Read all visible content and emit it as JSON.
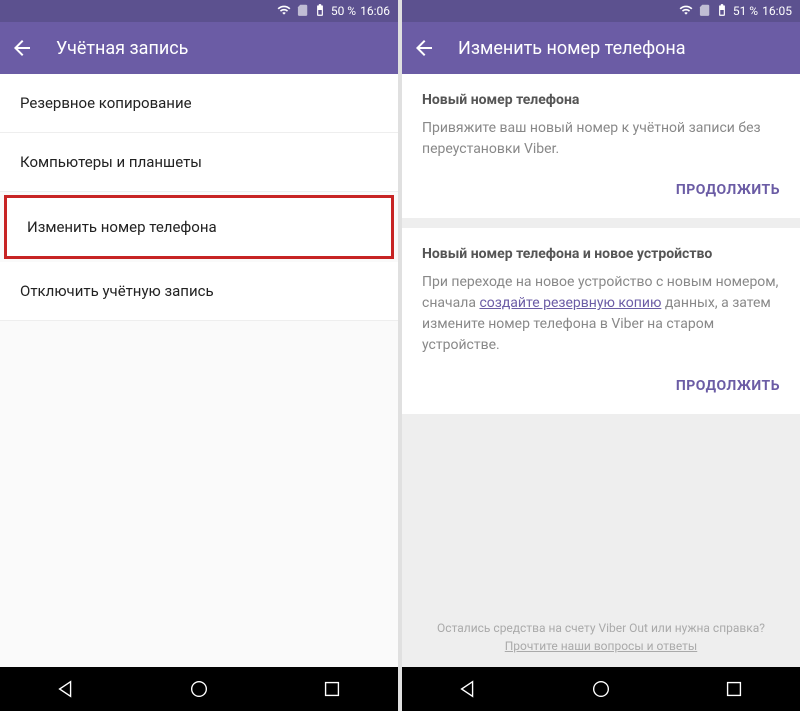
{
  "left": {
    "status": {
      "battery": "50 %",
      "time": "16:06"
    },
    "appbar_title": "Учётная запись",
    "items": [
      {
        "label": "Резервное копирование"
      },
      {
        "label": "Компьютеры и планшеты"
      },
      {
        "label": "Изменить номер телефона"
      },
      {
        "label": "Отключить учётную запись"
      }
    ]
  },
  "right": {
    "status": {
      "battery": "51 %",
      "time": "16:05"
    },
    "appbar_title": "Изменить номер телефона",
    "card1": {
      "title": "Новый номер телефона",
      "body": "Привяжите ваш новый номер к учётной записи без переустановки Viber.",
      "action": "ПРОДОЛЖИТЬ"
    },
    "card2": {
      "title": "Новый номер телефона и новое устройство",
      "body_pre": "При переходе на новое устройство с новым номером, сначала ",
      "body_link": "создайте резервную копию",
      "body_post": " данных, а затем измените номер телефона в Viber на старом устройстве.",
      "action": "ПРОДОЛЖИТЬ"
    },
    "footer": {
      "line1": "Остались средства на счету Viber Out или нужна справка?",
      "link": "Прочтите наши вопросы и ответы"
    }
  }
}
